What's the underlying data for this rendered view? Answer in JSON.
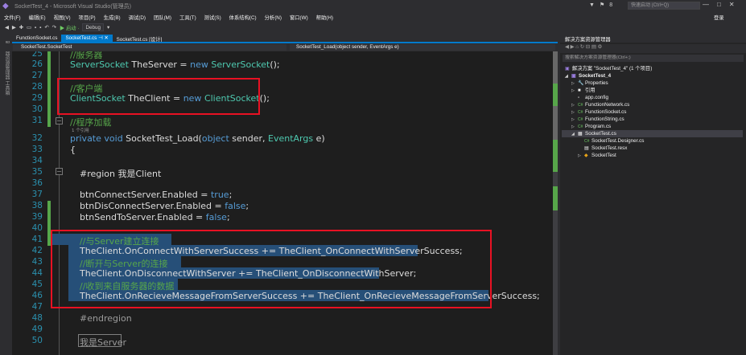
{
  "window": {
    "title": "SocketTest_4 - Microsoft Visual Studio(管理员)",
    "notifications": "8",
    "quick_launch_placeholder": "快速启动 (Ctrl+Q)",
    "login_label": "登录"
  },
  "menu": [
    "文件(F)",
    "编辑(E)",
    "视图(V)",
    "项目(P)",
    "生成(B)",
    "调试(D)",
    "团队(M)",
    "工具(T)",
    "测试(S)",
    "体系结构(C)",
    "分析(N)",
    "窗口(W)",
    "帮助(H)"
  ],
  "toolbar": {
    "start_label": "▶ 启动 ·",
    "config_label": "Debug"
  },
  "doc_tabs": [
    {
      "label": "FunctionSocket.cs",
      "active": false
    },
    {
      "label": "SocketTest.cs",
      "active": true
    },
    {
      "label": "SocketTest.cs [设计]",
      "active": false
    }
  ],
  "nav": {
    "left": "SocketTest.SocketTest",
    "right": "SocketTest_Load(object sender, EventArgs e)"
  },
  "left_strip_label": "服务器资源管理器 工具箱",
  "editor": {
    "line_numbers": [
      "25",
      "26",
      "27",
      "28",
      "29",
      "30",
      "31",
      "32",
      "33",
      "34",
      "35",
      "36",
      "37",
      "38",
      "39",
      "40",
      "41",
      "42",
      "43",
      "44",
      "45",
      "46",
      "47",
      "48",
      "49",
      "50"
    ],
    "codelens": "1 个引用",
    "lines": {
      "l25": "//服务器",
      "l26a": "ServerSocket",
      "l26b": " TheServer = ",
      "l26c": "new",
      "l26d": " ",
      "l26e": "ServerSocket",
      "l26f": "();",
      "l28": "//客户端",
      "l29a": "ClientSocket",
      "l29b": " TheClient = ",
      "l29c": "new",
      "l29d": " ",
      "l29e": "ClientSocket",
      "l29f": "();",
      "l31": "//程序加载",
      "l32a": "private",
      "l32b": " ",
      "l32c": "void",
      "l32d": " SocketTest_Load(",
      "l32e": "object",
      "l32f": " sender, ",
      "l32g": "EventArgs",
      "l32h": " e)",
      "l33": "{",
      "l35": "#region 我是Client",
      "l37a": "btnConnectServer.Enabled = ",
      "l37b": "true",
      "l37c": ";",
      "l38a": "btnDisConnectServer.Enabled = ",
      "l38b": "false",
      "l38c": ";",
      "l39a": "btnSendToServer.Enabled = ",
      "l39b": "false",
      "l39c": ";",
      "l41": "//与Server建立连接",
      "l42": "TheClient.OnConnectWithServerSuccess += TheClient_OnConnectWithServerSuccess;",
      "l43": "//断开与Server的连接",
      "l44": "TheClient.OnDisconnectWithServer += TheClient_OnDisconnectWithServer;",
      "l45": "//收到来自服务器的数据",
      "l46": "TheClient.OnRecieveMessageFromServerSuccess += TheClient_OnRecieveMessageFromServerSuccess;",
      "l48": "#endregion",
      "l50": "我是Server"
    }
  },
  "solution_explorer": {
    "title": "解决方案资源管理器",
    "search_placeholder": "搜索解决方案资源管理器(Ctrl+;)",
    "items": [
      {
        "label": "解决方案 \"SocketTest_4\" (1 个项目)",
        "icon": "solution-icon",
        "depth": 0,
        "bold": false
      },
      {
        "label": "SocketTest_4",
        "icon": "project-icon",
        "depth": 0,
        "bold": true
      },
      {
        "label": "Properties",
        "icon": "wrench-icon",
        "depth": 1,
        "bold": false
      },
      {
        "label": "引用",
        "icon": "references-icon",
        "depth": 1,
        "bold": false
      },
      {
        "label": "app.config",
        "icon": "config-icon",
        "depth": 1,
        "bold": false
      },
      {
        "label": "FunctionNetwork.cs",
        "icon": "csharp-file-icon",
        "depth": 1,
        "bold": false
      },
      {
        "label": "FunctionSocket.cs",
        "icon": "csharp-file-icon",
        "depth": 1,
        "bold": false
      },
      {
        "label": "FunctionString.cs",
        "icon": "csharp-file-icon",
        "depth": 1,
        "bold": false
      },
      {
        "label": "Program.cs",
        "icon": "csharp-file-icon",
        "depth": 1,
        "bold": false
      },
      {
        "label": "SocketTest.cs",
        "icon": "form-icon",
        "depth": 1,
        "bold": false
      },
      {
        "label": "SocketTest.Designer.cs",
        "icon": "csharp-file-icon",
        "depth": 2,
        "bold": false
      },
      {
        "label": "SocketTest.resx",
        "icon": "resx-icon",
        "depth": 2,
        "bold": false
      },
      {
        "label": "SocketTest",
        "icon": "class-icon",
        "depth": 2,
        "bold": false
      }
    ]
  },
  "colors": {
    "accent": "#007acc",
    "editor_bg": "#1e1e1e",
    "keyword": "#569cd6",
    "type": "#4ec9b0",
    "comment": "#57a64a",
    "highlight_box": "#e81123"
  }
}
